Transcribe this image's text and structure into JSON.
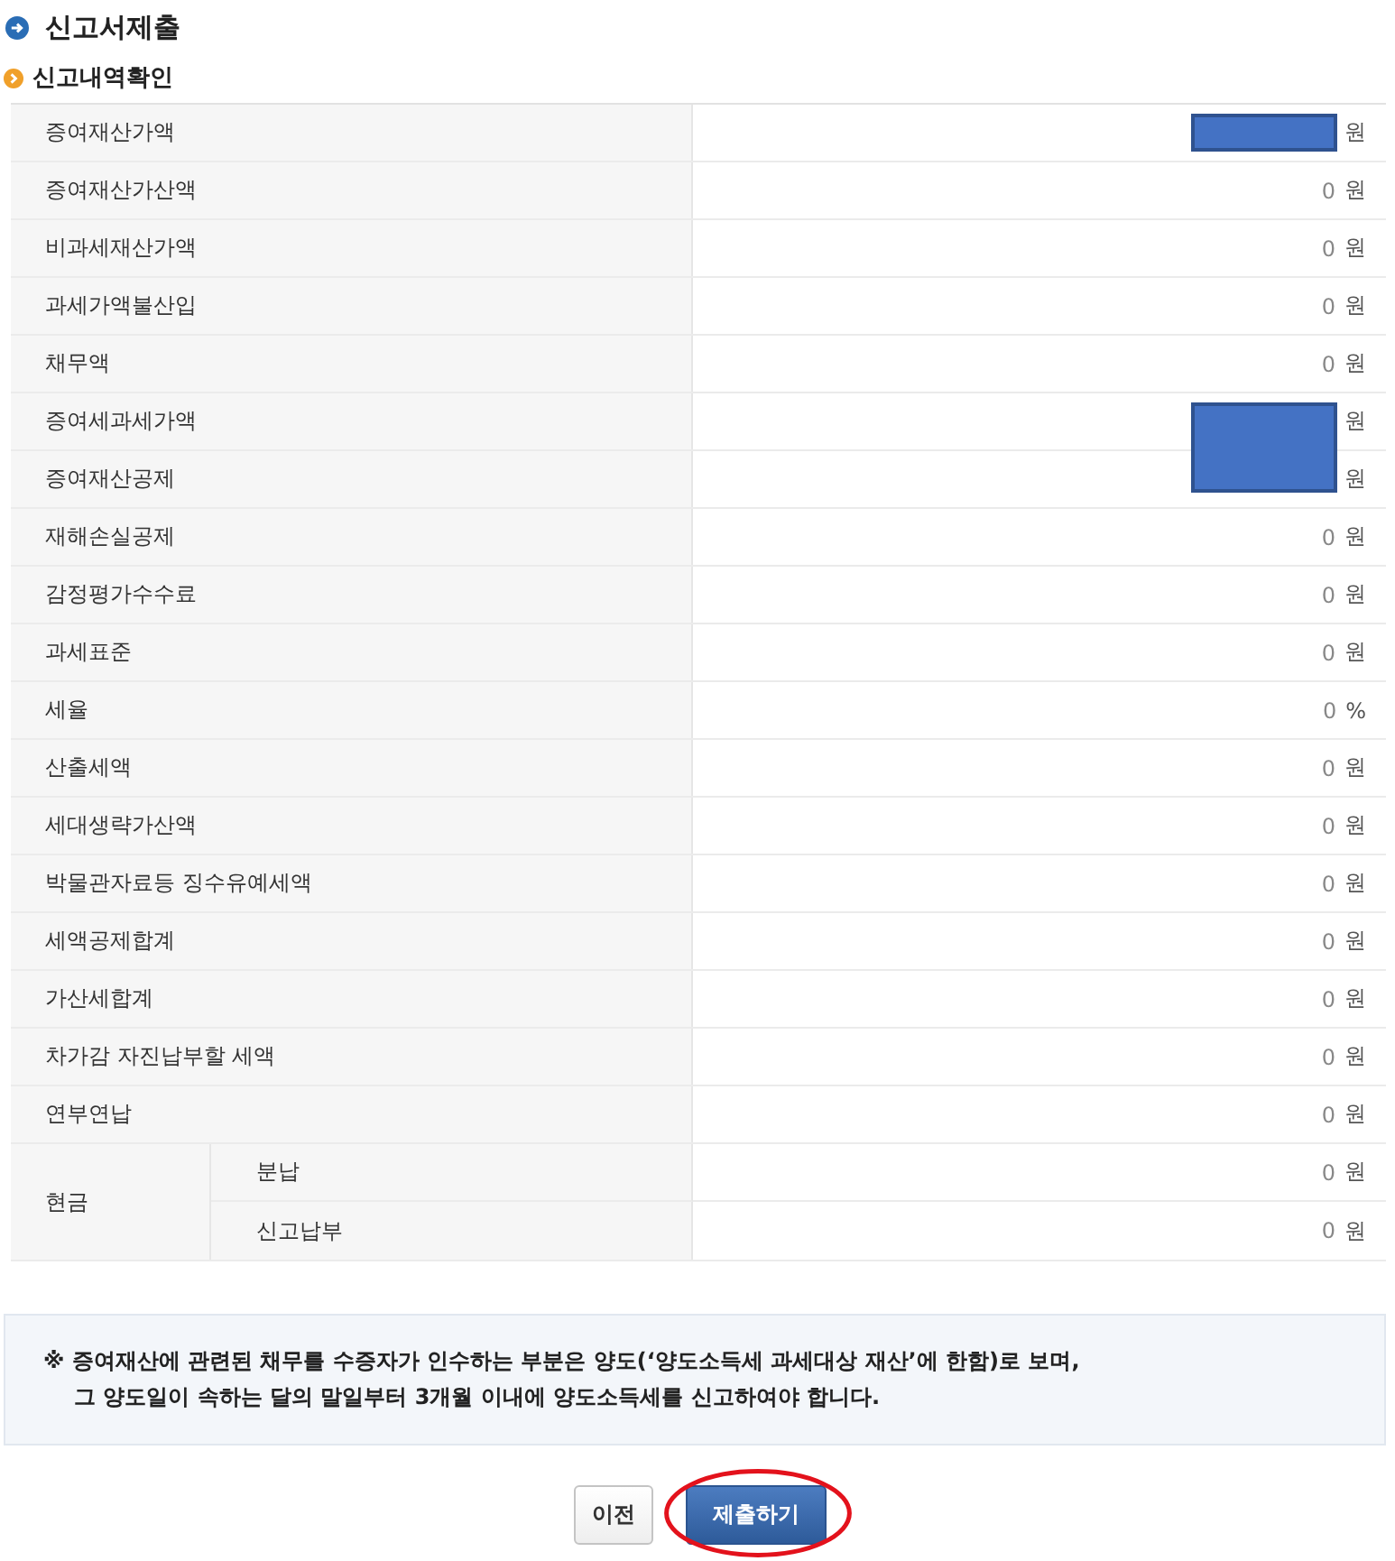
{
  "page": {
    "title": "신고서제출"
  },
  "section": {
    "title": "신고내역확인"
  },
  "table": {
    "rows": [
      {
        "kind": "single",
        "label": "증여재산가액",
        "redacted": true,
        "unit": "원"
      },
      {
        "kind": "single",
        "label": "증여재산가산액",
        "redacted": false,
        "value": "0",
        "unit": "원"
      },
      {
        "kind": "single",
        "label": "비과세재산가액",
        "redacted": false,
        "value": "0",
        "unit": "원"
      },
      {
        "kind": "single",
        "label": "과세가액불산입",
        "redacted": false,
        "value": "0",
        "unit": "원"
      },
      {
        "kind": "single",
        "label": "채무액",
        "redacted": false,
        "value": "0",
        "unit": "원"
      },
      {
        "kind": "single",
        "label": "증여세과세가액",
        "redacted": true,
        "unit": "원"
      },
      {
        "kind": "single",
        "label": "증여재산공제",
        "redacted": true,
        "unit": "원"
      },
      {
        "kind": "single",
        "label": "재해손실공제",
        "redacted": false,
        "value": "0",
        "unit": "원"
      },
      {
        "kind": "single",
        "label": "감정평가수수료",
        "redacted": false,
        "value": "0",
        "unit": "원"
      },
      {
        "kind": "single",
        "label": "과세표준",
        "redacted": false,
        "value": "0",
        "unit": "원"
      },
      {
        "kind": "single",
        "label": "세율",
        "redacted": false,
        "value": "0",
        "unit": "%"
      },
      {
        "kind": "single",
        "label": "산출세액",
        "redacted": false,
        "value": "0",
        "unit": "원"
      },
      {
        "kind": "single",
        "label": "세대생략가산액",
        "redacted": false,
        "value": "0",
        "unit": "원"
      },
      {
        "kind": "single",
        "label": "박물관자료등 징수유예세액",
        "redacted": false,
        "value": "0",
        "unit": "원"
      },
      {
        "kind": "single",
        "label": "세액공제합계",
        "redacted": false,
        "value": "0",
        "unit": "원"
      },
      {
        "kind": "single",
        "label": "가산세합계",
        "redacted": false,
        "value": "0",
        "unit": "원"
      },
      {
        "kind": "single",
        "label": "차가감 자진납부할 세액",
        "redacted": false,
        "value": "0",
        "unit": "원"
      },
      {
        "kind": "single",
        "label": "연부연납",
        "redacted": false,
        "value": "0",
        "unit": "원"
      },
      {
        "kind": "group",
        "label": "현금",
        "children": [
          {
            "label": "분납",
            "redacted": false,
            "value": "0",
            "unit": "원"
          },
          {
            "label": "신고납부",
            "redacted": false,
            "value": "0",
            "unit": "원"
          }
        ]
      }
    ]
  },
  "notice": {
    "lines": [
      "※ 증여재산에 관련된 채무를 수증자가 인수하는 부분은 양도(‘양도소득세 과세대상 재산’에 한함)로 보며,",
      "그 양도일이 속하는 달의 말일부터 3개월 이내에 양도소득세를 신고하여야 합니다."
    ]
  },
  "buttons": [
    {
      "label": "이전",
      "kind": "secondary",
      "highlighted": false
    },
    {
      "label": "제출하기",
      "kind": "primary",
      "highlighted": true
    }
  ]
}
